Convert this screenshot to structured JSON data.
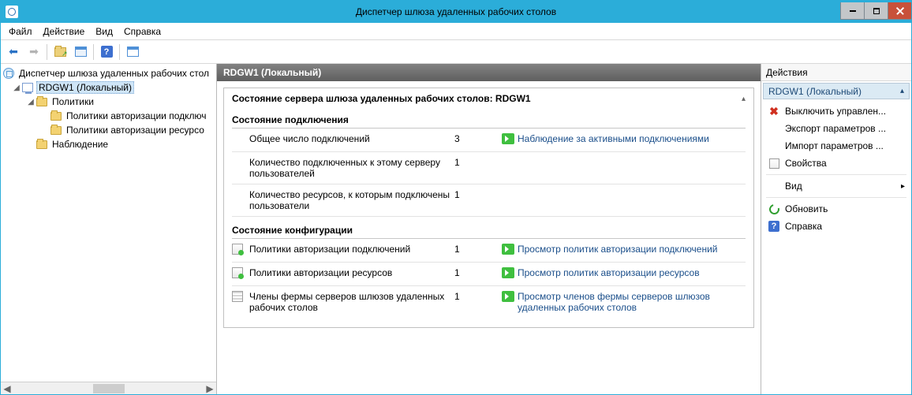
{
  "window_title": "Диспетчер шлюза удаленных рабочих столов",
  "menubar": [
    "Файл",
    "Действие",
    "Вид",
    "Справка"
  ],
  "tree": {
    "root": "Диспетчер шлюза удаленных рабочих стол",
    "server": "RDGW1 (Локальный)",
    "policies": "Политики",
    "cap": "Политики авторизации подключ",
    "rap": "Политики авторизации ресурсо",
    "monitoring": "Наблюдение"
  },
  "center": {
    "header": "RDGW1 (Локальный)",
    "status_title": "Состояние сервера шлюза удаленных рабочих столов: RDGW1",
    "section_conn": "Состояние подключения",
    "rows_conn": [
      {
        "label": "Общее число подключений",
        "value": "3",
        "link": "Наблюдение за активными подключениями"
      },
      {
        "label": "Количество подключенных к этому серверу пользователей",
        "value": "1",
        "link": ""
      },
      {
        "label": "Количество ресурсов, к которым подключены пользователи",
        "value": "1",
        "link": ""
      }
    ],
    "section_cfg": "Состояние конфигурации",
    "rows_cfg": [
      {
        "icon": "policy",
        "label": "Политики авторизации подключений",
        "value": "1",
        "link": "Просмотр политик авторизации подключений"
      },
      {
        "icon": "policy",
        "label": "Политики авторизации ресурсов",
        "value": "1",
        "link": "Просмотр политик авторизации ресурсов"
      },
      {
        "icon": "farm",
        "label": "Члены фермы серверов шлюзов удаленных рабочих столов",
        "value": "1",
        "link": "Просмотр членов фермы серверов шлюзов удаленных рабочих столов"
      }
    ]
  },
  "actions": {
    "header": "Действия",
    "context": "RDGW1 (Локальный)",
    "items": [
      {
        "icon": "x",
        "label": "Выключить управлен..."
      },
      {
        "icon": "",
        "label": "Экспорт параметров ..."
      },
      {
        "icon": "",
        "label": "Импорт параметров ..."
      },
      {
        "icon": "prop",
        "label": "Свойства"
      },
      {
        "sep": true
      },
      {
        "icon": "",
        "label": "Вид",
        "submenu": true
      },
      {
        "sep": true
      },
      {
        "icon": "refresh",
        "label": "Обновить"
      },
      {
        "icon": "help",
        "label": "Справка"
      }
    ]
  }
}
